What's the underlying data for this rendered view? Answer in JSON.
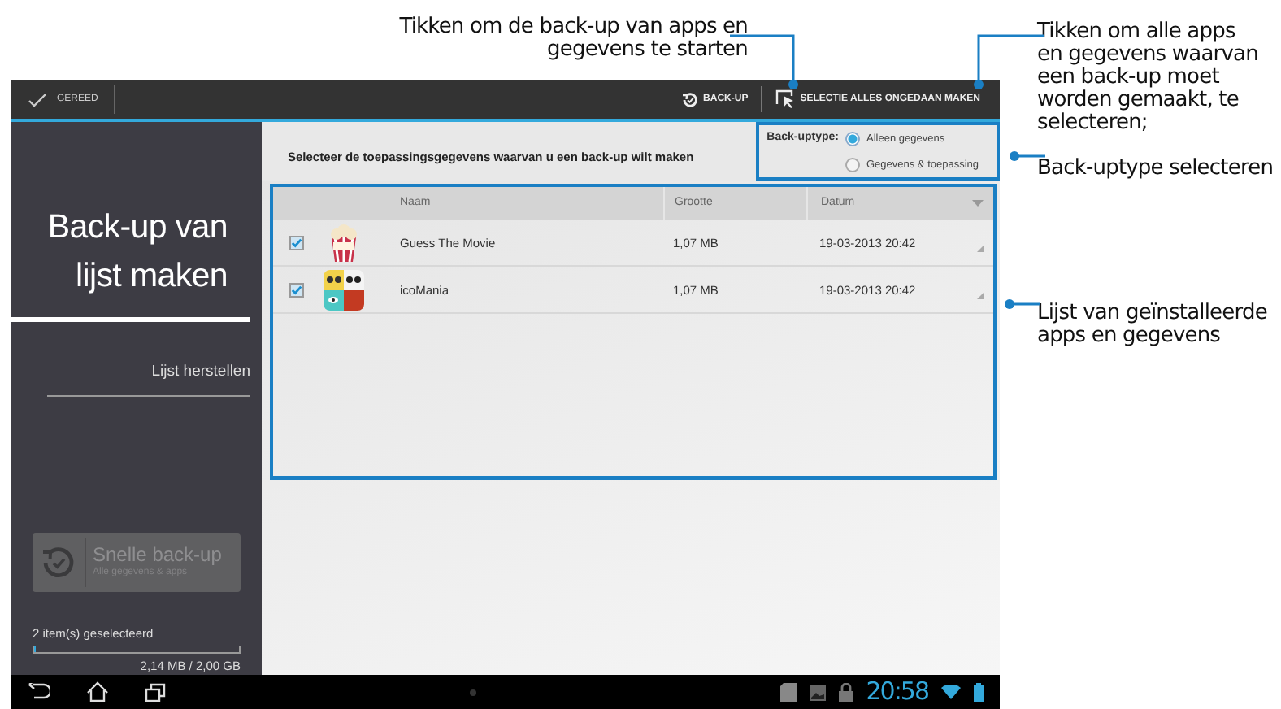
{
  "callouts": {
    "backup": "Tikken om de back-up van apps en gegevens te starten",
    "select_all": "Tikken om alle apps en gegevens waarvan een back-up moet worden gemaakt, te selecteren;",
    "backup_type": "Back-uptype selecteren",
    "app_list": "Lijst van geïnstalleerde apps en gegevens"
  },
  "action_bar": {
    "done": "GEREED",
    "actions": [
      {
        "kind": "backup",
        "label": "BACK-UP"
      },
      {
        "kind": "select",
        "label": "SELECTIE ALLES ONGEDAAN MAKEN"
      }
    ]
  },
  "sidebar": {
    "tabs": [
      {
        "label": "Back-up van lijst maken",
        "selected": true
      },
      {
        "label": "Lijst herstellen",
        "selected": false
      }
    ],
    "quick_backup": {
      "title": "Snelle back-up",
      "subtitle": "Alle gegevens & apps",
      "disabled": true
    },
    "selection": "2 item(s) geselecteerd",
    "storage": {
      "level": 0.002,
      "reading": "2,14 MB / 2,00 GB"
    }
  },
  "content": {
    "prompt": "Selecteer de toepassingsgegevens waarvan u een back-up wilt maken",
    "backup_type": {
      "label": "Back-uptype:",
      "options": [
        {
          "label": "Alleen gegevens",
          "selected": true
        },
        {
          "label": "Gegevens & toepassing",
          "selected": false
        }
      ]
    },
    "table": {
      "columns": [
        "Naam",
        "Grootte",
        "Datum"
      ],
      "rows": [
        {
          "checked": true,
          "kind": "movie",
          "name": "Guess The Movie",
          "size": "1,07 MB",
          "date": "19-03-2013 20:42"
        },
        {
          "checked": true,
          "kind": "icons",
          "name": "icoMania",
          "size": "1,07 MB",
          "date": "19-03-2013 20:42"
        }
      ]
    }
  },
  "nav_bar": {
    "time": "20:58"
  }
}
